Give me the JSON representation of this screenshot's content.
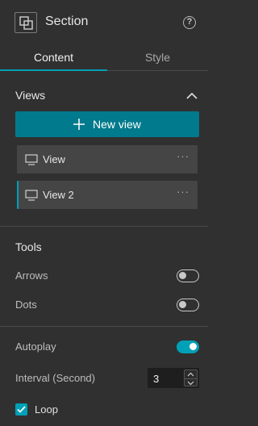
{
  "header": {
    "title": "Section",
    "help_glyph": "?"
  },
  "tabs": [
    {
      "label": "Content",
      "active": true
    },
    {
      "label": "Style",
      "active": false
    }
  ],
  "views": {
    "title": "Views",
    "new_view_label": "New view",
    "items": [
      {
        "label": "View",
        "more": "···",
        "selected": false
      },
      {
        "label": "View 2",
        "more": "···",
        "selected": true
      }
    ]
  },
  "tools": {
    "title": "Tools",
    "arrows_label": "Arrows",
    "arrows_on": false,
    "dots_label": "Dots",
    "dots_on": false
  },
  "playback": {
    "autoplay_label": "Autoplay",
    "autoplay_on": true,
    "interval_label": "Interval (Second)",
    "interval_value": "3",
    "loop_label": "Loop",
    "loop_checked": true
  },
  "colors": {
    "accent": "#00a0b6",
    "button": "#007a8c",
    "background": "#303030"
  }
}
